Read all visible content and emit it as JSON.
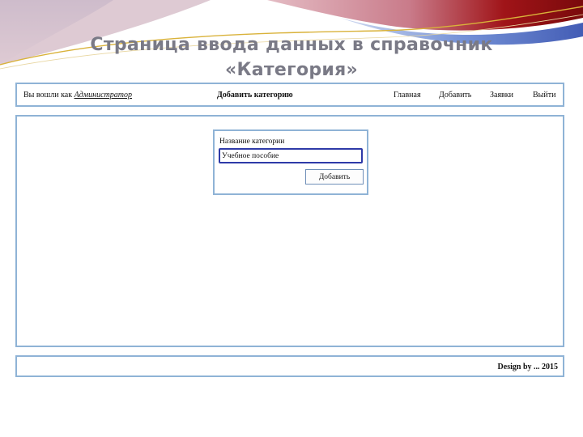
{
  "slide": {
    "title_line1": "Страница ввода данных в справочник",
    "title_line2": "«Категория»"
  },
  "header": {
    "login_prefix": "Вы вошли как",
    "login_user": "Администратор",
    "page_heading": "Добавить категорию",
    "nav": {
      "home": "Главная",
      "add": "Добавить",
      "requests": "Заявки",
      "logout": "Выйти"
    }
  },
  "form": {
    "field_label": "Название категории",
    "field_value": "Учебное пособие",
    "submit_label": "Добавить"
  },
  "footer": {
    "credit": "Design by ... 2015"
  },
  "colors": {
    "panel_border": "#8fb3d6",
    "input_border": "#2e3aa8",
    "title_gray": "#7a7a86",
    "deco_red": "#b01818",
    "deco_blue": "#2a4fb0"
  }
}
